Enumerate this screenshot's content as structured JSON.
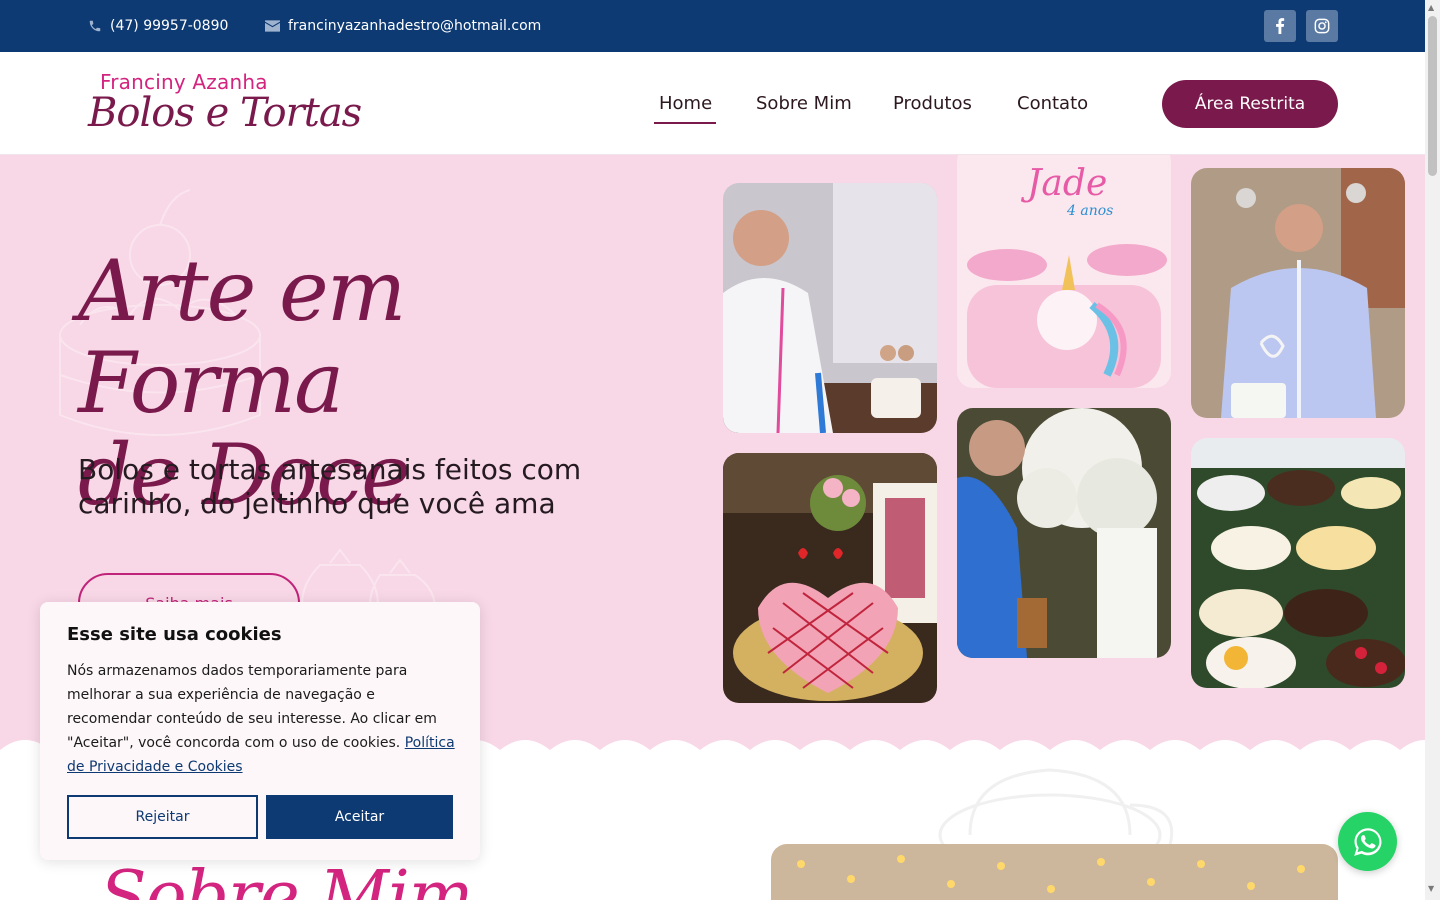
{
  "topbar": {
    "phone": "(47) 99957-0890",
    "email": "francinyazanhadestro@hotmail.com",
    "social": [
      "facebook-icon",
      "instagram-icon"
    ]
  },
  "header": {
    "logo_line1": "Franciny Azanha",
    "logo_line2": "Bolos e Tortas",
    "nav": {
      "home": "Home",
      "sobre": "Sobre Mim",
      "produtos": "Produtos",
      "contato": "Contato"
    },
    "active": "Home",
    "cta": "Área Restrita"
  },
  "hero": {
    "title_line1": "Arte em Forma",
    "title_line2": "de Doce",
    "subtitle": "Bolos e tortas artesanais feitos com carinho, do jeitinho que você ama",
    "button": "Saiba mais",
    "photo_topper_text": "Jade",
    "photo_topper_sub": "4 anos"
  },
  "about": {
    "title": "Sobre Mim"
  },
  "cookie": {
    "title": "Esse site usa cookies",
    "text": "Nós armazenamos dados temporariamente para melhorar a sua experiência de navegação e recomendar conteúdo de seu interesse. Ao clicar em \"Aceitar\", você concorda com o uso de cookies.",
    "link": "Política de Privacidade e Cookies",
    "reject": "Rejeitar",
    "accept": "Aceitar"
  },
  "colors": {
    "topbar": "#0e3a73",
    "brand": "#7a1a4c",
    "hero_bg": "#f8d7e6",
    "accent_pink": "#d3247f",
    "whatsapp": "#25d366"
  }
}
